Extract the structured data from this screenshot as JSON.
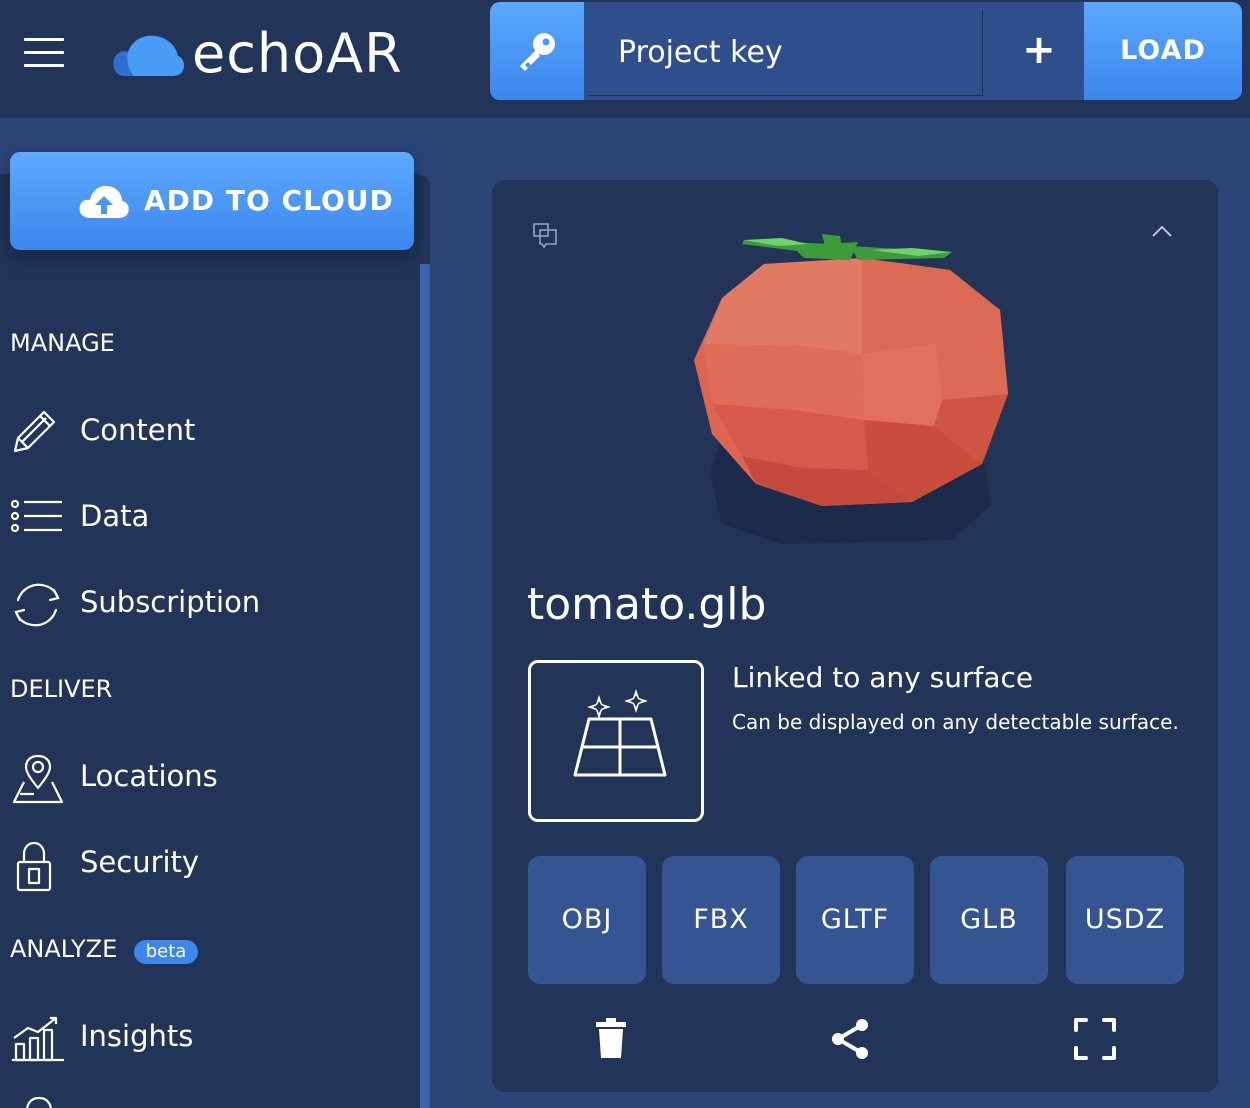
{
  "header": {
    "brand": "echoAR",
    "project_key_placeholder": "Project key",
    "add_label": "+",
    "load_label": "LOAD"
  },
  "sidebar": {
    "add_to_cloud_label": "ADD TO CLOUD",
    "sections": [
      {
        "title": "MANAGE",
        "items": [
          {
            "label": "Content",
            "icon": "pencil-icon"
          },
          {
            "label": "Data",
            "icon": "list-icon"
          },
          {
            "label": "Subscription",
            "icon": "sync-icon"
          }
        ]
      },
      {
        "title": "DELIVER",
        "items": [
          {
            "label": "Locations",
            "icon": "map-pin-icon"
          },
          {
            "label": "Security",
            "icon": "lock-icon"
          }
        ]
      },
      {
        "title": "ANALYZE",
        "badge": "beta",
        "items": [
          {
            "label": "Insights",
            "icon": "chart-icon"
          }
        ]
      }
    ]
  },
  "card": {
    "filename": "tomato.glb",
    "surface_title": "Linked to any surface",
    "surface_desc": "Can be displayed on any detectable surface.",
    "formats": [
      "OBJ",
      "FBX",
      "GLTF",
      "GLB",
      "USDZ"
    ]
  },
  "colors": {
    "header_bg": "#223559",
    "page_bg": "#2c4577",
    "accent": "#4a95f5",
    "format_button": "#355592",
    "tomato": "#e0644f"
  }
}
